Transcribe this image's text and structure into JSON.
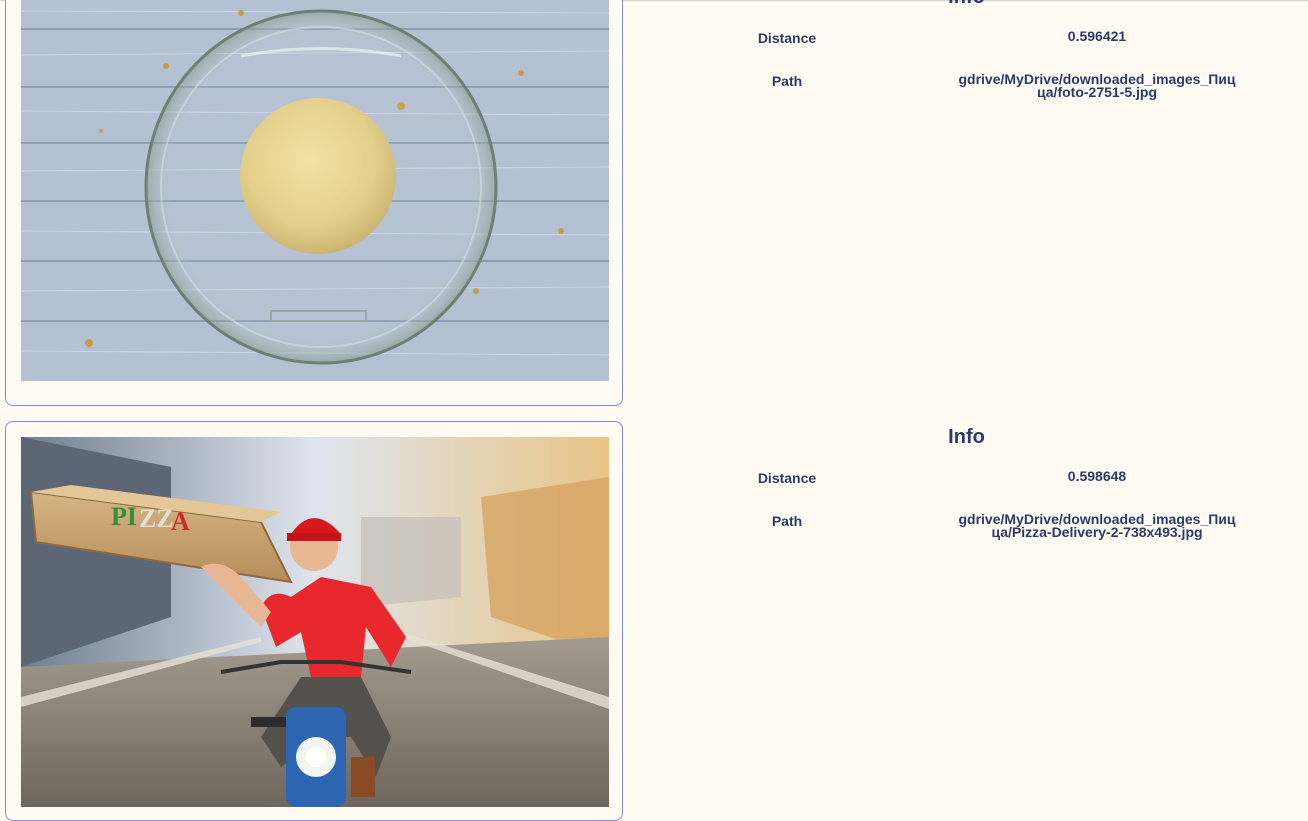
{
  "results": [
    {
      "image_desc": "dough-ball-in-glass-bowl",
      "info_title": "Info",
      "distance_label": "Distance",
      "distance_value": "0.596421",
      "path_label": "Path",
      "path_value": "gdrive/MyDrive/downloaded_images_Пиц ца/foto-2751-5.jpg"
    },
    {
      "image_desc": "pizza-delivery-man-on-moped",
      "image_text": "PIZZA",
      "info_title": "Info",
      "distance_label": "Distance",
      "distance_value": "0.598648",
      "path_label": "Path",
      "path_value": "gdrive/MyDrive/downloaded_images_Пиц ца/Pizza-Delivery-2-738x493.jpg"
    }
  ],
  "colors": {
    "background": "#fffbf3",
    "text": "#2b3a6e",
    "card_border": "#7f8fcf"
  }
}
